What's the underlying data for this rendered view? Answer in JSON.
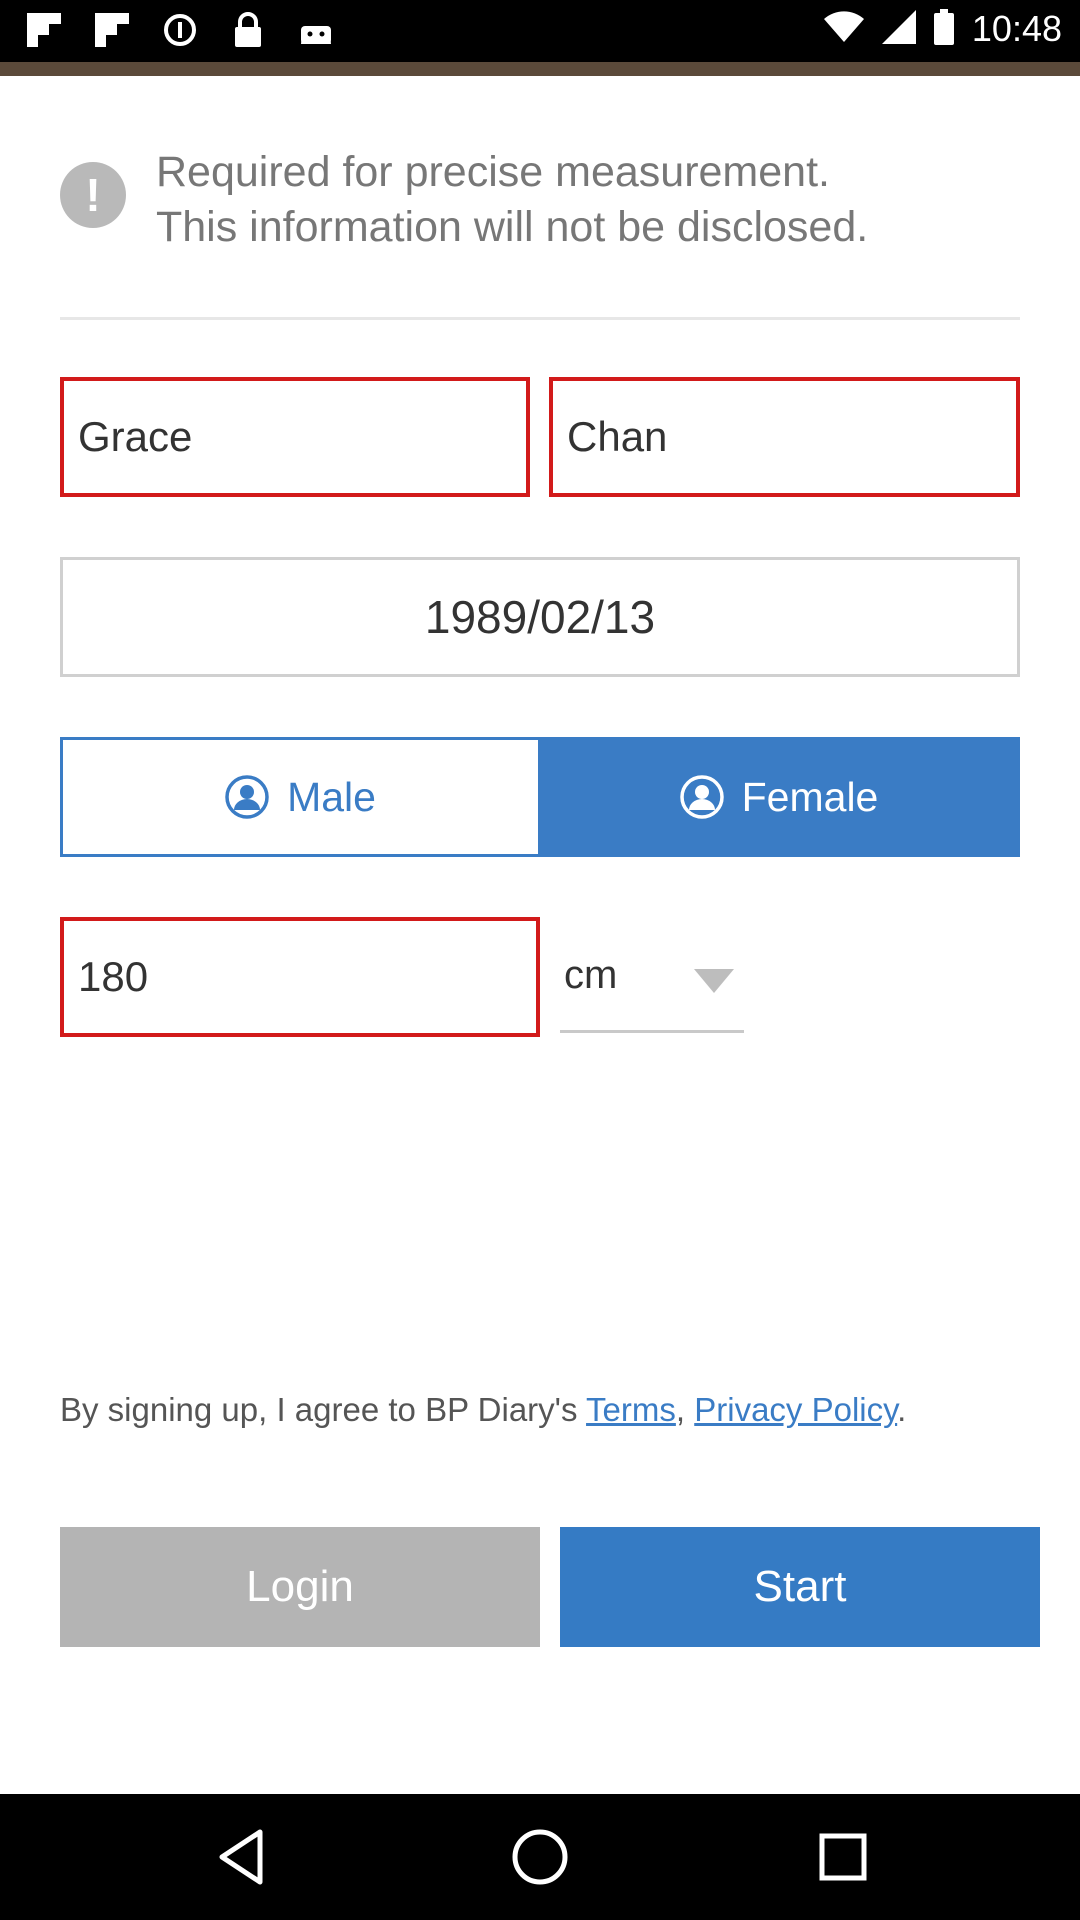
{
  "status_bar": {
    "time": "10:48",
    "icons": [
      "flipboard-icon",
      "flipboard-icon",
      "mi-fit-icon",
      "lock-icon",
      "android-icon"
    ],
    "right_icons": [
      "wifi-icon",
      "signal-icon",
      "battery-icon"
    ]
  },
  "notice": {
    "icon": "exclamation-icon",
    "line1": "Required for precise measurement.",
    "line2": "This information will not be disclosed."
  },
  "form": {
    "first_name": "Grace",
    "last_name": "Chan",
    "birth_date": "1989/02/13",
    "gender": {
      "male_label": "Male",
      "female_label": "Female",
      "selected": "Female"
    },
    "height_value": "180",
    "height_unit": "cm"
  },
  "terms": {
    "prefix": "By signing up, I agree to BP Diary's ",
    "terms_link": "Terms",
    "separator": ", ",
    "privacy_link": "Privacy Policy",
    "suffix": "."
  },
  "buttons": {
    "login_label": "Login",
    "start_label": "Start"
  },
  "colors": {
    "accent": "#357bc4",
    "error_border": "#d21a1a",
    "disabled_button": "#b4b4b4"
  }
}
